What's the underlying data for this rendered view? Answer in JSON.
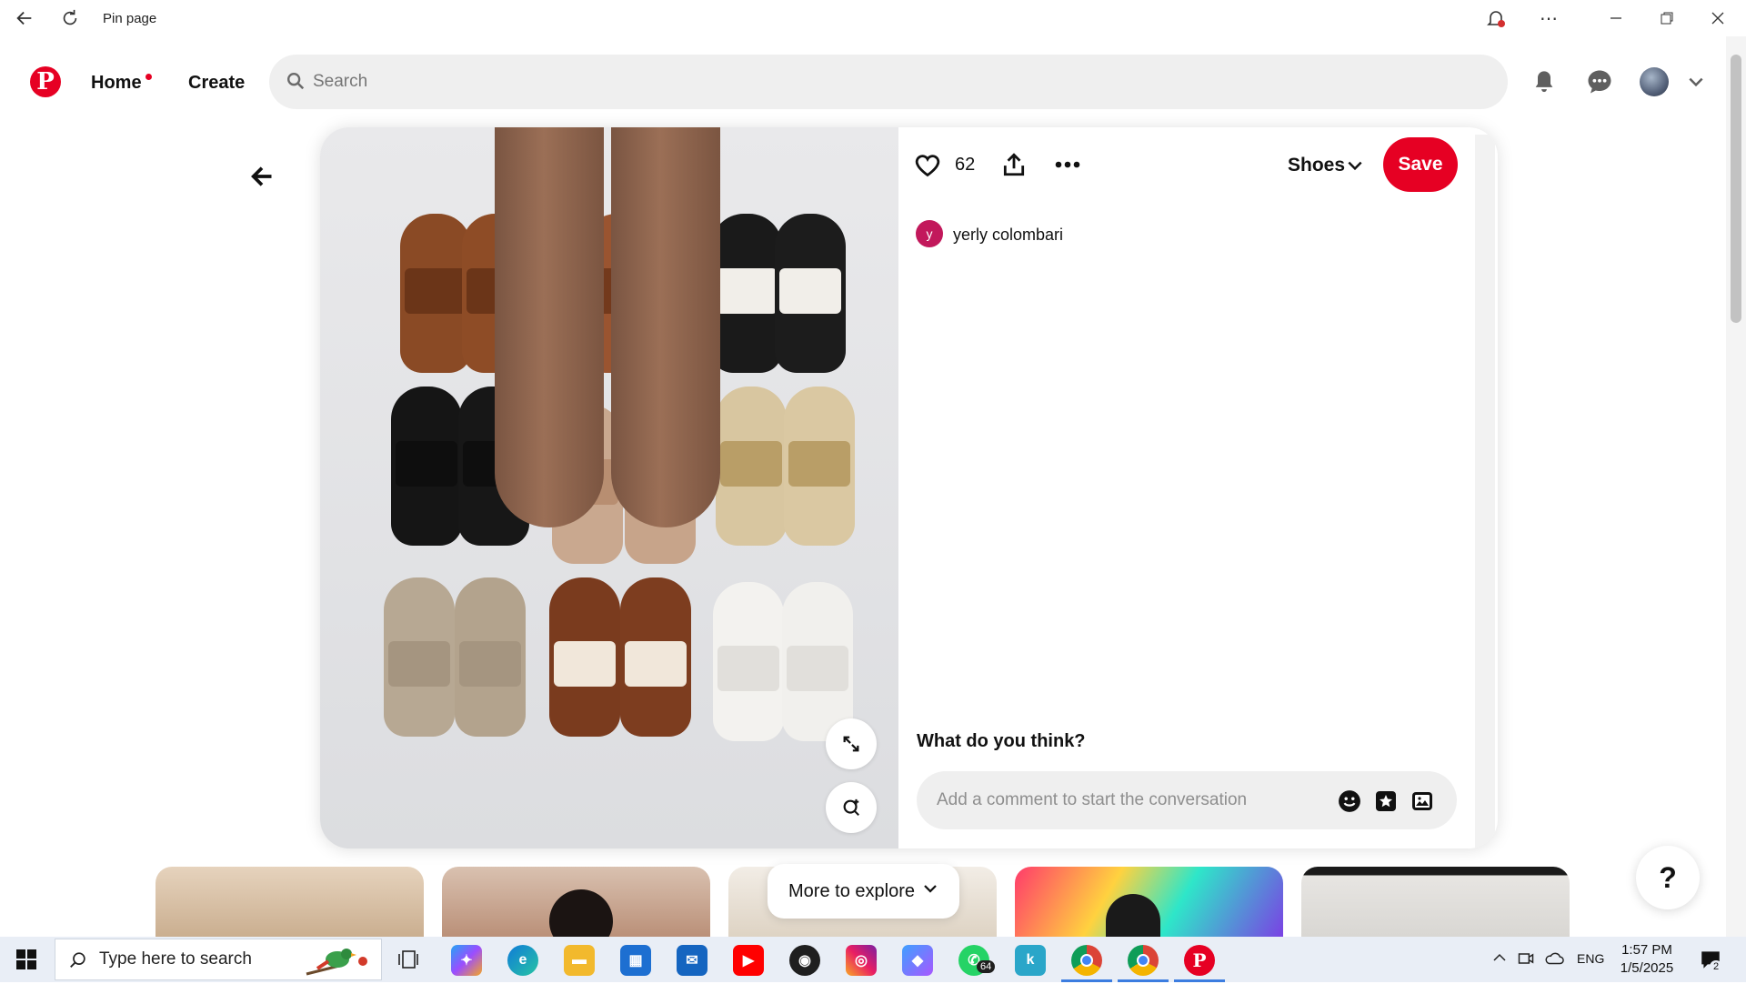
{
  "window": {
    "title": "Pin page"
  },
  "nav": {
    "home_label": "Home",
    "create_label": "Create",
    "search_placeholder": "Search"
  },
  "pin": {
    "like_count": "62",
    "board_name": "Shoes",
    "save_label": "Save",
    "creator_initial": "y",
    "creator_name": "yerly colombari",
    "comments_heading": "What do you think?",
    "comment_placeholder": "Add a comment to start the conversation"
  },
  "feed": {
    "more_label": "More to explore"
  },
  "help": {
    "label": "?"
  },
  "taskbar": {
    "search_placeholder": "Type here to search",
    "whatsapp_badge": "64",
    "language": "ENG",
    "time": "1:57 PM",
    "date": "1/5/2025",
    "notifications_badge": "2"
  },
  "colors": {
    "brand": "#e60023",
    "accent": "#3c7de0"
  }
}
